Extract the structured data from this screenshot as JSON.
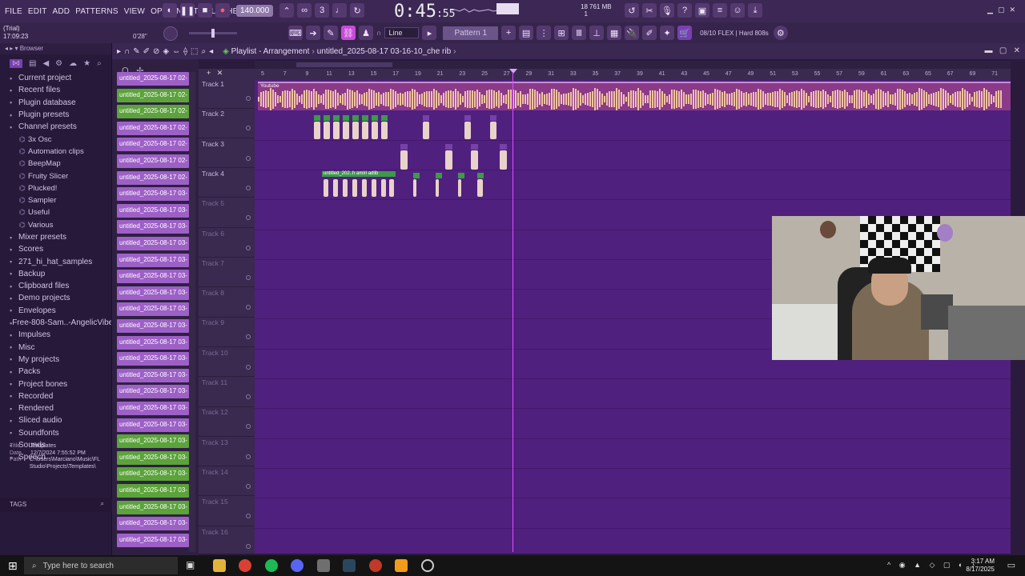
{
  "menus": [
    "FILE",
    "EDIT",
    "ADD",
    "PATTERNS",
    "VIEW",
    "OPTIONS",
    "TOOLS",
    "HELP"
  ],
  "status": {
    "trial": "(Trial)",
    "time": "17:09:23",
    "hint_time": "0'28\""
  },
  "transport": {
    "bpm": "140.000",
    "song_time": "0:45",
    "song_time_small": ":55",
    "cpu": "18",
    "memory": "761 MB",
    "voices": "1"
  },
  "toolbar2": {
    "snap": "Line",
    "pattern": "Pattern 1",
    "preset_counter": "08/10",
    "preset_name": "FLEX | Hard 808s"
  },
  "browser": {
    "title": "Browser",
    "items": [
      {
        "label": "Current project",
        "level": 0
      },
      {
        "label": "Recent files",
        "level": 0
      },
      {
        "label": "Plugin database",
        "level": 0
      },
      {
        "label": "Plugin presets",
        "level": 0
      },
      {
        "label": "Channel presets",
        "level": 0
      },
      {
        "label": "3x Osc",
        "level": 1
      },
      {
        "label": "Automation clips",
        "level": 1
      },
      {
        "label": "BeepMap",
        "level": 1
      },
      {
        "label": "Fruity Slicer",
        "level": 1
      },
      {
        "label": "Plucked!",
        "level": 1
      },
      {
        "label": "Sampler",
        "level": 1
      },
      {
        "label": "Useful",
        "level": 1
      },
      {
        "label": "Various",
        "level": 1
      },
      {
        "label": "Mixer presets",
        "level": 0
      },
      {
        "label": "Scores",
        "level": 0
      },
      {
        "label": "271_hi_hat_samples",
        "level": 0
      },
      {
        "label": "Backup",
        "level": 0
      },
      {
        "label": "Clipboard files",
        "level": 0
      },
      {
        "label": "Demo projects",
        "level": 0
      },
      {
        "label": "Envelopes",
        "level": 0
      },
      {
        "label": "Free-808-Sam..-AngelicVibes",
        "level": 0
      },
      {
        "label": "Impulses",
        "level": 0
      },
      {
        "label": "Misc",
        "level": 0
      },
      {
        "label": "My projects",
        "level": 0
      },
      {
        "label": "Packs",
        "level": 0
      },
      {
        "label": "Project bones",
        "level": 0
      },
      {
        "label": "Recorded",
        "level": 0
      },
      {
        "label": "Rendered",
        "level": 0
      },
      {
        "label": "Sliced audio",
        "level": 0
      },
      {
        "label": "Soundfonts",
        "level": 0
      },
      {
        "label": "Sounds",
        "level": 0
      },
      {
        "label": "Speech",
        "level": 0
      }
    ],
    "info": {
      "title_key": "Title",
      "title_val": "Templates",
      "date_key": "Date",
      "date_val": "12/7/2024 7:55:52 PM",
      "path_key": "Path",
      "path_val": "C:\\Users\\Marciano\\Music\\FL Studio\\Projects\\Templates\\"
    },
    "tags_label": "TAGS"
  },
  "playlist": {
    "section": "Playlist - Arrangement",
    "project": "untitled_2025-08-17 03-16-10_che rib",
    "audio_clip_label": "Youtube",
    "pattern_clip_label": "untitled_202..h amiri adlib",
    "ruler": [
      "5",
      "7",
      "9",
      "11",
      "13",
      "15",
      "17",
      "19",
      "21",
      "23",
      "25",
      "27",
      "29",
      "31",
      "33",
      "35",
      "37",
      "39",
      "41",
      "43",
      "45",
      "47",
      "49",
      "51",
      "53",
      "55",
      "57",
      "59",
      "61",
      "63",
      "65",
      "67",
      "69",
      "71"
    ],
    "tracks": [
      "Track 1",
      "Track 2",
      "Track 3",
      "Track 4",
      "Track 5",
      "Track 6",
      "Track 7",
      "Track 8",
      "Track 9",
      "Track 10",
      "Track 11",
      "Track 12",
      "Track 13",
      "Track 14",
      "Track 15",
      "Track 16"
    ]
  },
  "channels": [
    {
      "label": "untitled_2025-08-17 02-",
      "green": false
    },
    {
      "label": "untitled_2025-08-17 02-",
      "green": true
    },
    {
      "label": "untitled_2025-08-17 02-",
      "green": true
    },
    {
      "label": "untitled_2025-08-17 02-",
      "green": false
    },
    {
      "label": "untitled_2025-08-17 02-",
      "green": false
    },
    {
      "label": "untitled_2025-08-17 02-",
      "green": false
    },
    {
      "label": "untitled_2025-08-17 02-",
      "green": false
    },
    {
      "label": "untitled_2025-08-17 03-",
      "green": false
    },
    {
      "label": "untitled_2025-08-17 03-",
      "green": false
    },
    {
      "label": "untitled_2025-08-17 03-",
      "green": false
    },
    {
      "label": "untitled_2025-08-17 03-",
      "green": false
    },
    {
      "label": "untitled_2025-08-17 03-",
      "green": false
    },
    {
      "label": "untitled_2025-08-17 03-",
      "green": false
    },
    {
      "label": "untitled_2025-08-17 03-",
      "green": false
    },
    {
      "label": "untitled_2025-08-17 03-",
      "green": false
    },
    {
      "label": "untitled_2025-08-17 03-",
      "green": false
    },
    {
      "label": "untitled_2025-08-17 03-",
      "green": false
    },
    {
      "label": "untitled_2025-08-17 03-",
      "green": false
    },
    {
      "label": "untitled_2025-08-17 03-",
      "green": false
    },
    {
      "label": "untitled_2025-08-17 03-",
      "green": false
    },
    {
      "label": "untitled_2025-08-17 03-",
      "green": false
    },
    {
      "label": "untitled_2025-08-17 03-",
      "green": false
    },
    {
      "label": "untitled_2025-08-17 03-",
      "green": true
    },
    {
      "label": "untitled_2025-08-17 03-",
      "green": true
    },
    {
      "label": "untitled_2025-08-17 03-",
      "green": true
    },
    {
      "label": "untitled_2025-08-17 03-",
      "green": true
    },
    {
      "label": "untitled_2025-08-17 03-",
      "green": true
    },
    {
      "label": "untitled_2025-08-17 03-",
      "green": false
    },
    {
      "label": "untitled_2025-08-17 03-",
      "green": false
    }
  ],
  "taskbar": {
    "search_placeholder": "Type here to search",
    "time": "3:17 AM",
    "date": "8/17/2025"
  },
  "colors": {
    "accent": "#e14bff",
    "grid": "#50207e",
    "clip_purple": "#9d60c6",
    "clip_green": "#5ba33a"
  }
}
